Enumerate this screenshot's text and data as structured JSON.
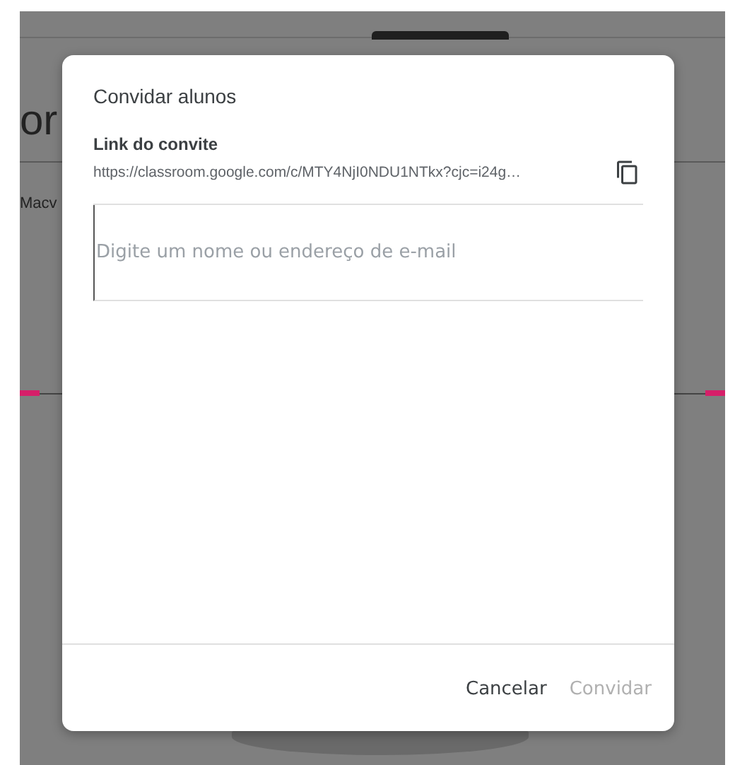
{
  "background": {
    "heading_fragment": "or",
    "text_fragment": "Macv"
  },
  "dialog": {
    "title": "Convidar alunos",
    "link_label": "Link do convite",
    "link_url": "https://classroom.google.com/c/MTY4NjI0NDU1NTkx?cjc=i24g…",
    "search": {
      "placeholder": "Digite um nome ou endereço de e-mail",
      "focused": true
    },
    "buttons": [
      {
        "label": "Cancelar",
        "disabled": false
      },
      {
        "label": "Convidar",
        "disabled": true
      }
    ]
  }
}
